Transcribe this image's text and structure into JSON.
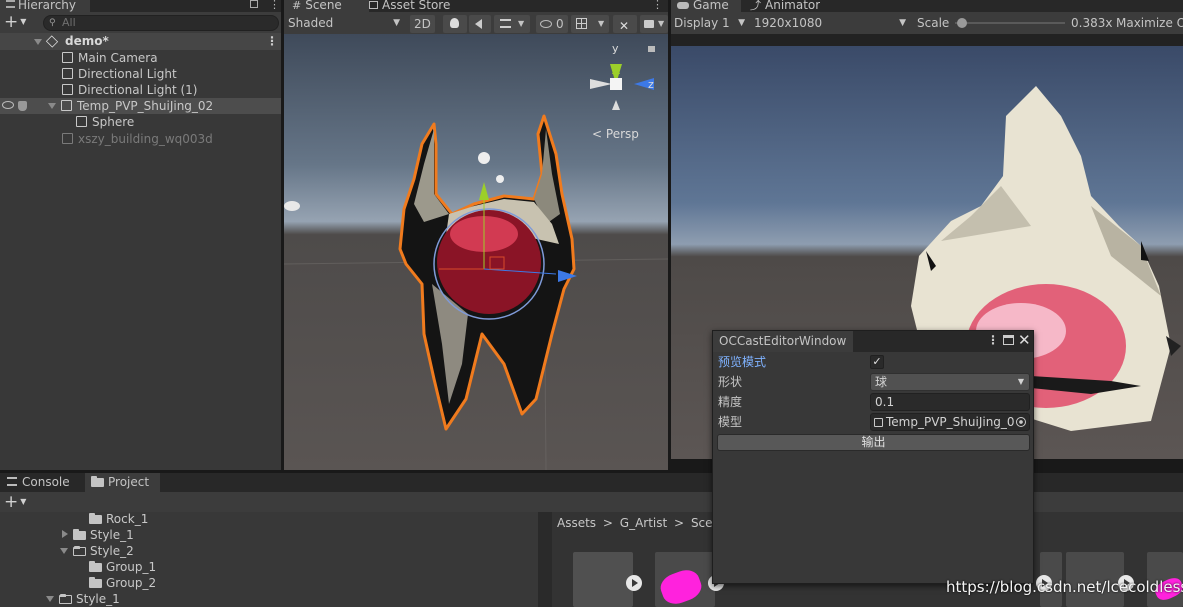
{
  "hierarchy": {
    "tab_label": "Hierarchy",
    "search_placeholder": "All",
    "scene_name": "demo*",
    "items": [
      {
        "label": "Main Camera"
      },
      {
        "label": "Directional Light"
      },
      {
        "label": "Directional Light (1)"
      },
      {
        "label": "Temp_PVP_ShuiJing_02"
      },
      {
        "label": "Sphere"
      },
      {
        "label": "xszy_building_wq003d"
      }
    ]
  },
  "scene_view": {
    "tabs": [
      {
        "label": "Scene"
      },
      {
        "label": "Asset Store"
      }
    ],
    "shading_mode": "Shaded",
    "btn_2d": "2D",
    "hidden_count": "0",
    "gizmo_axes": {
      "y": "y",
      "z": "z"
    },
    "persp_label": "Persp"
  },
  "game_view": {
    "tabs": [
      {
        "label": "Game"
      },
      {
        "label": "Animator"
      }
    ],
    "display": "Display 1",
    "resolution": "1920x1080",
    "scale_label": "Scale",
    "scale_value": "0.383",
    "scale_fraction": 0.02,
    "scale_suffix": "x",
    "maximize_label": "Maximize O"
  },
  "bottom": {
    "tabs": [
      {
        "label": "Console"
      },
      {
        "label": "Project"
      }
    ],
    "tree": [
      {
        "label": "Rock_1"
      },
      {
        "label": "Style_1"
      },
      {
        "label": "Style_2"
      },
      {
        "label": "Group_1"
      },
      {
        "label": "Group_2"
      },
      {
        "label": "Style_1"
      }
    ],
    "breadcrumb": [
      "Assets",
      "G_Artist",
      "Scene"
    ]
  },
  "oc_window": {
    "title": "OCCastEditorWindow",
    "rows": {
      "preview_mode_label": "预览模式",
      "preview_mode_checked": "✓",
      "shape_label": "形状",
      "shape_value": "球",
      "precision_label": "精度",
      "precision_value": "0.1",
      "model_label": "模型",
      "model_value": "Temp_PVP_ShuiJing_0"
    },
    "output_button": "输出"
  },
  "watermark": "https://blog.csdn.net/lcecoldless",
  "colors": {
    "selection": "#4d4d4d",
    "preview_label": "#7fb2ff",
    "outline": "#f07b1e",
    "magenta": "#ff22dd"
  }
}
